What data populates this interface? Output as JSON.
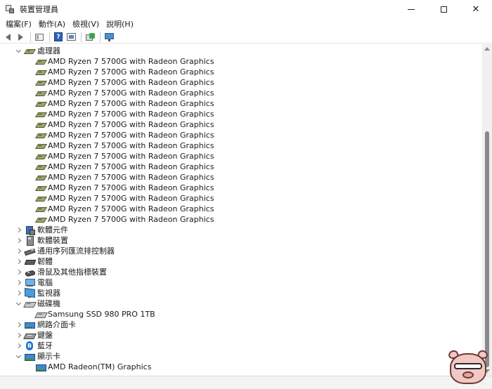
{
  "window": {
    "title": "裝置管理員",
    "controls": {
      "minimize": "",
      "maximize": "",
      "close": "✕"
    }
  },
  "menu": {
    "items": [
      "檔案(F)",
      "動作(A)",
      "檢視(V)",
      "說明(H)"
    ]
  },
  "toolbar": {
    "buttons": [
      "back-icon",
      "forward-icon",
      "properties-icon",
      "help-icon",
      "scan-hardware-icon",
      "update-driver-icon",
      "monitor-icon"
    ]
  },
  "tree": {
    "processors": {
      "label": "處理器",
      "expanded": true,
      "children": [
        "AMD Ryzen 7 5700G with Radeon Graphics",
        "AMD Ryzen 7 5700G with Radeon Graphics",
        "AMD Ryzen 7 5700G with Radeon Graphics",
        "AMD Ryzen 7 5700G with Radeon Graphics",
        "AMD Ryzen 7 5700G with Radeon Graphics",
        "AMD Ryzen 7 5700G with Radeon Graphics",
        "AMD Ryzen 7 5700G with Radeon Graphics",
        "AMD Ryzen 7 5700G with Radeon Graphics",
        "AMD Ryzen 7 5700G with Radeon Graphics",
        "AMD Ryzen 7 5700G with Radeon Graphics",
        "AMD Ryzen 7 5700G with Radeon Graphics",
        "AMD Ryzen 7 5700G with Radeon Graphics",
        "AMD Ryzen 7 5700G with Radeon Graphics",
        "AMD Ryzen 7 5700G with Radeon Graphics",
        "AMD Ryzen 7 5700G with Radeon Graphics",
        "AMD Ryzen 7 5700G with Radeon Graphics"
      ]
    },
    "software_components": {
      "label": "軟體元件"
    },
    "software_devices": {
      "label": "軟體裝置"
    },
    "usb_controllers": {
      "label": "通用序列匯流排控制器"
    },
    "firmware": {
      "label": "韌體"
    },
    "mice": {
      "label": "滑鼠及其他指標裝置"
    },
    "computer": {
      "label": "電腦"
    },
    "monitors": {
      "label": "監視器"
    },
    "disk_drives": {
      "label": "磁碟機",
      "expanded": true,
      "children": [
        "Samsung SSD 980 PRO 1TB"
      ]
    },
    "network_adapters": {
      "label": "網路介面卡"
    },
    "keyboards": {
      "label": "鍵盤"
    },
    "bluetooth": {
      "label": "藍牙"
    },
    "display_adapters": {
      "label": "顯示卡",
      "expanded": true,
      "children": [
        "AMD Radeon(TM) Graphics"
      ]
    }
  },
  "colors": {
    "accent": "#2b62b8",
    "processor_icon": "#a0a26e",
    "scrollbar_thumb": "#8a8a8a"
  }
}
